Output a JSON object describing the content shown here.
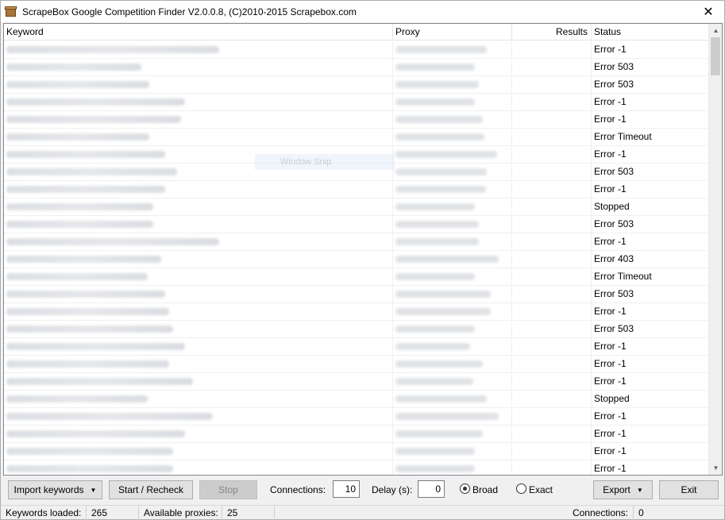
{
  "window": {
    "title": "ScrapeBox Google Competition Finder V2.0.0.8, (C)2010-2015 Scrapebox.com",
    "close_glyph": "✕"
  },
  "table": {
    "columns": [
      "Keyword",
      "Proxy",
      "Results",
      "Status"
    ],
    "rows": [
      {
        "status": "Error -1"
      },
      {
        "status": "Error 503"
      },
      {
        "status": "Error 503"
      },
      {
        "status": "Error -1"
      },
      {
        "status": "Error -1"
      },
      {
        "status": "Error Timeout"
      },
      {
        "status": "Error -1"
      },
      {
        "status": "Error 503"
      },
      {
        "status": "Error -1"
      },
      {
        "status": "Stopped"
      },
      {
        "status": "Error 503"
      },
      {
        "status": "Error -1"
      },
      {
        "status": "Error 403"
      },
      {
        "status": "Error Timeout"
      },
      {
        "status": "Error 503"
      },
      {
        "status": "Error -1"
      },
      {
        "status": "Error 503"
      },
      {
        "status": "Error -1"
      },
      {
        "status": "Error -1"
      },
      {
        "status": "Error -1"
      },
      {
        "status": "Stopped"
      },
      {
        "status": "Error -1"
      },
      {
        "status": "Error -1"
      },
      {
        "status": "Error -1"
      },
      {
        "status": "Error -1"
      }
    ],
    "overlay_text": "Window Snip"
  },
  "toolbar": {
    "import_label": "Import keywords",
    "start_label": "Start / Recheck",
    "stop_label": "Stop",
    "connections_label": "Connections:",
    "connections_value": "10",
    "delay_label": "Delay (s):",
    "delay_value": "0",
    "broad_label": "Broad",
    "exact_label": "Exact",
    "export_label": "Export",
    "exit_label": "Exit",
    "match_mode": "Broad"
  },
  "statusbar": {
    "keywords_label": "Keywords loaded:",
    "keywords_value": "265",
    "proxies_label": "Available proxies:",
    "proxies_value": "25",
    "connections_label": "Connections:",
    "connections_value": "0"
  }
}
